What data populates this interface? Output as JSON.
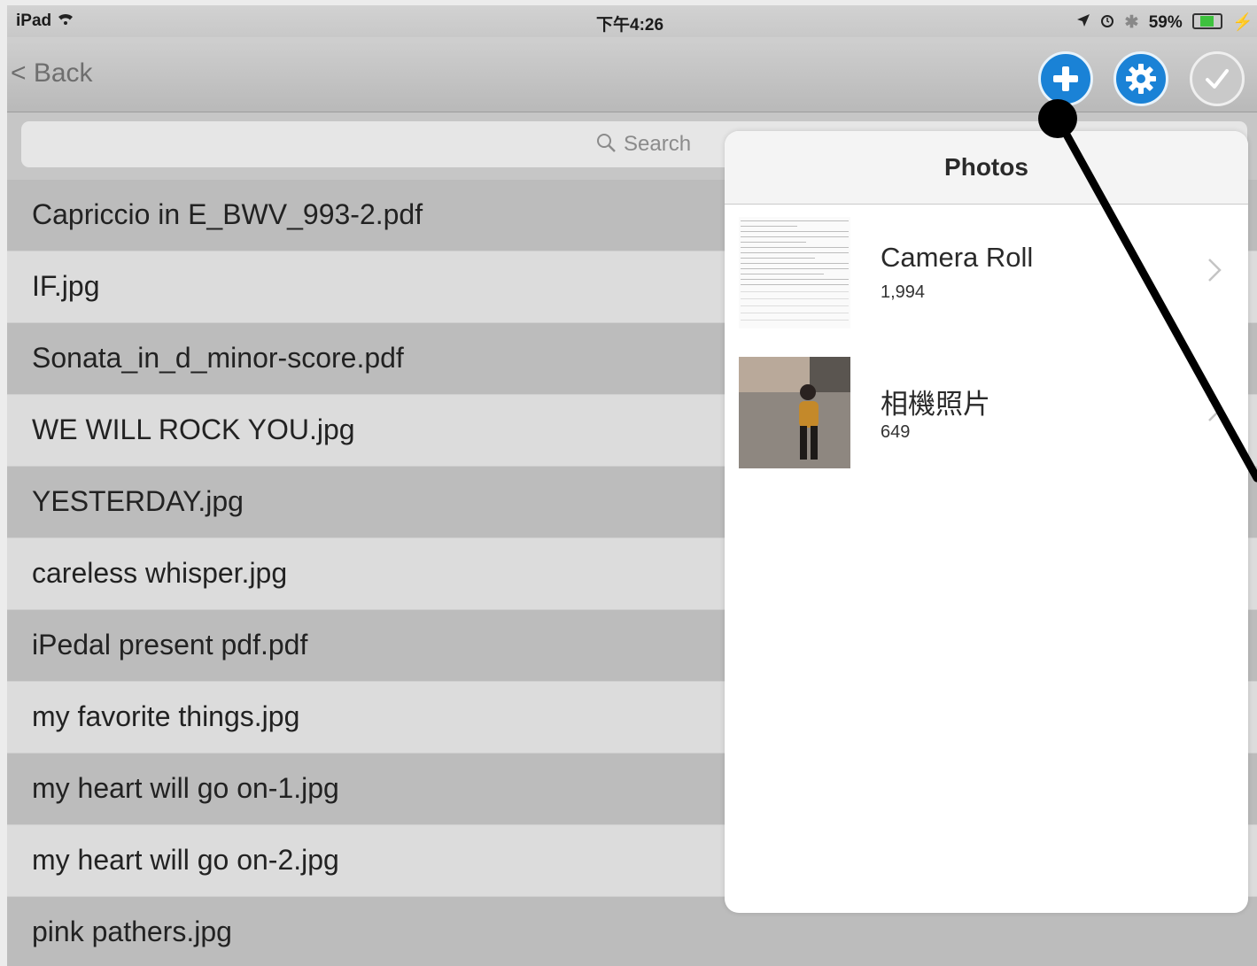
{
  "statusbar": {
    "device": "iPad",
    "time": "下午4:26",
    "battery": "59%",
    "battery_level": 0.59,
    "icons": [
      "wifi-icon",
      "location-icon",
      "alarm-icon",
      "bluetooth-icon",
      "battery-icon",
      "charging-icon"
    ]
  },
  "navbar": {
    "back_label": "< Back",
    "buttons": [
      "add-icon",
      "gear-icon",
      "checkmark-icon"
    ],
    "accent_color": "#1a82d6"
  },
  "search": {
    "placeholder": "Search"
  },
  "files": [
    "Capriccio in E_BWV_993-2.pdf",
    "IF.jpg",
    "Sonata_in_d_minor-score.pdf",
    "WE WILL ROCK YOU.jpg",
    "YESTERDAY.jpg",
    "careless whisper.jpg",
    "iPedal present pdf.pdf",
    "my favorite things.jpg",
    "my heart will go on-1.jpg",
    "my heart will go on-2.jpg",
    "pink pathers.jpg"
  ],
  "popover": {
    "title": "Photos",
    "albums": [
      {
        "name": "Camera Roll",
        "count": "1,994"
      },
      {
        "name": "相機照片",
        "count": "649"
      }
    ]
  }
}
